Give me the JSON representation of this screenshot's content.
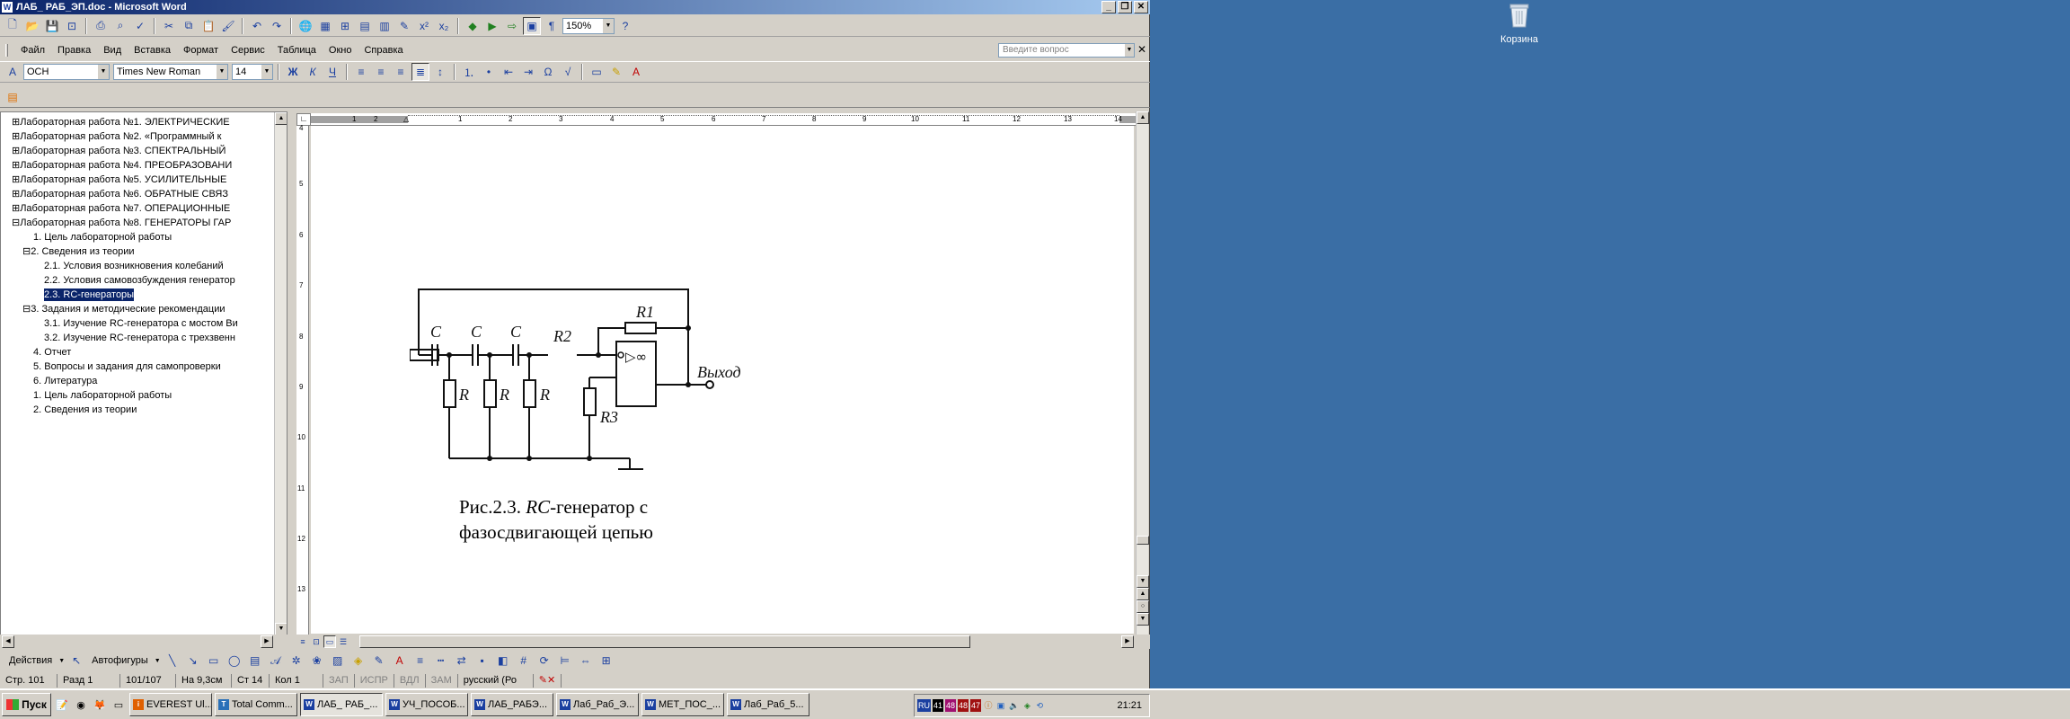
{
  "window": {
    "title": "ЛАБ_ РАБ_ЭП.doc - Microsoft Word",
    "buttons": [
      "_",
      "❐",
      "✕"
    ]
  },
  "standard_toolbar": {
    "zoom": "150%"
  },
  "menu": {
    "items": [
      "Файл",
      "Правка",
      "Вид",
      "Вставка",
      "Формат",
      "Сервис",
      "Таблица",
      "Окно",
      "Справка"
    ],
    "ask_placeholder": "Введите вопрос"
  },
  "formatting_toolbar": {
    "style": "ОСН",
    "font": "Times New Roman",
    "size": "14"
  },
  "document_map": {
    "items": [
      {
        "text": "⊞Лабораторная работа №1.  ЭЛЕКТРИЧЕСКИЕ",
        "level": 0,
        "selected": false
      },
      {
        "text": "⊞Лабораторная работа №2.  «Программный к",
        "level": 0,
        "selected": false
      },
      {
        "text": "⊞Лабораторная работа №3.  СПЕКТРАЛЬНЫЙ",
        "level": 0,
        "selected": false
      },
      {
        "text": "⊞Лабораторная работа №4.  ПРЕОБРАЗОВАНИ",
        "level": 0,
        "selected": false
      },
      {
        "text": "⊞Лабораторная работа №5.  УСИЛИТЕЛЬНЫЕ",
        "level": 0,
        "selected": false
      },
      {
        "text": "⊞Лабораторная работа №6.  ОБРАТНЫЕ СВЯЗ",
        "level": 0,
        "selected": false
      },
      {
        "text": "⊞Лабораторная работа №7.  ОПЕРАЦИОННЫЕ",
        "level": 0,
        "selected": false
      },
      {
        "text": "⊟Лабораторная работа №8.  ГЕНЕРАТОРЫ ГАР",
        "level": 0,
        "selected": false
      },
      {
        "text": "1. Цель лабораторной работы",
        "level": 2,
        "selected": false
      },
      {
        "text": "⊟2. Сведения из теории",
        "level": 1,
        "selected": false
      },
      {
        "text": "2.1. Условия возникновения колебаний",
        "level": 3,
        "selected": false
      },
      {
        "text": "2.2. Условия самовозбуждения генератор",
        "level": 3,
        "selected": false
      },
      {
        "text": "2.3. RC-генераторы",
        "level": 3,
        "selected": true
      },
      {
        "text": "⊟3. Задания и методические рекомендации",
        "level": 1,
        "selected": false
      },
      {
        "text": "3.1. Изучение RC-генератора с мостом Ви",
        "level": 3,
        "selected": false
      },
      {
        "text": "3.2. Изучение RC-генератора с трехзвенн",
        "level": 3,
        "selected": false
      },
      {
        "text": "4. Отчет",
        "level": 2,
        "selected": false
      },
      {
        "text": "5. Вопросы и задания для самопроверки",
        "level": 2,
        "selected": false
      },
      {
        "text": "6. Литература",
        "level": 2,
        "selected": false
      },
      {
        "text": "1. Цель лабораторной работы",
        "level": 2,
        "selected": false
      },
      {
        "text": "2. Сведения из теории",
        "level": 2,
        "selected": false
      }
    ]
  },
  "document": {
    "circuit_labels": {
      "c": "C",
      "r": "R",
      "r1": "R1",
      "r2": "R2",
      "r3": "R3",
      "opamp": "▷∞",
      "output": "Выход"
    },
    "caption_line1_a": "Рис.2.3. ",
    "caption_line1_b": "RC",
    "caption_line1_c": "-генератор с",
    "caption_line2": "фазосдвигающей цепью"
  },
  "drawing_toolbar": {
    "actions": "Действия",
    "autoshapes": "Автофигуры"
  },
  "status": {
    "page": "Стр. 101",
    "section": "Разд 1",
    "pages": "101/107",
    "at": "На 9,3см",
    "line": "Ст 14",
    "col": "Кол 1",
    "rec": "ЗАП",
    "trk": "ИСПР",
    "ext": "ВДЛ",
    "ovr": "ЗАМ",
    "lang": "русский (Ро"
  },
  "taskbar": {
    "start": "Пуск",
    "buttons": [
      "EVEREST Ul...",
      "Total Comm...",
      "ЛАБ_ РАБ_...",
      "УЧ_ПОСОБ...",
      "ЛАБ_РАБЭ...",
      "Лаб_Раб_Э...",
      "МЕТ_ПОС_...",
      "Лаб_Раб_5..."
    ],
    "active_index": 2,
    "tray": {
      "lang": "RU",
      "temps": [
        "41",
        "48",
        "48",
        "47"
      ],
      "clock": "21:21"
    }
  },
  "desktop": {
    "recycle_bin": "Корзина"
  },
  "colors": {
    "desktop": "#3a6ea5",
    "title_start": "#0a246a",
    "title_end": "#a6caf0",
    "selection": "#0a246a",
    "chrome": "#d4d0c8"
  }
}
